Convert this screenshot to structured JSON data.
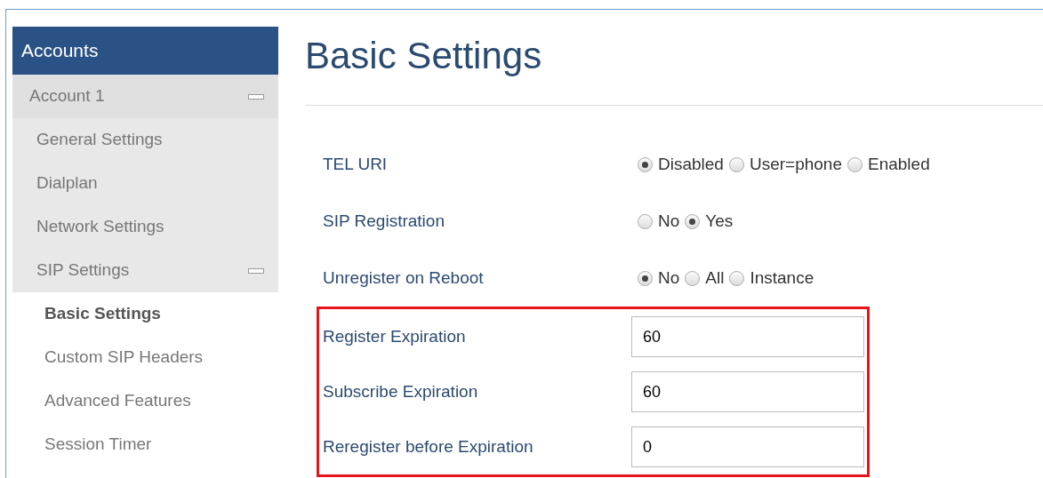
{
  "sidebar": {
    "header": "Accounts",
    "items": [
      {
        "kind": "group",
        "label": "Account 1",
        "expanded": true,
        "selected": false
      },
      {
        "kind": "item",
        "label": "General Settings",
        "selected": false
      },
      {
        "kind": "item",
        "label": "Dialplan",
        "selected": false
      },
      {
        "kind": "item",
        "label": "Network Settings",
        "selected": false
      },
      {
        "kind": "item",
        "label": "SIP Settings",
        "expanded": true,
        "selected": false
      },
      {
        "kind": "subitem",
        "label": "Basic Settings",
        "selected": true
      },
      {
        "kind": "subitem",
        "label": "Custom SIP Headers",
        "selected": false
      },
      {
        "kind": "subitem",
        "label": "Advanced Features",
        "selected": false
      },
      {
        "kind": "subitem",
        "label": "Session Timer",
        "selected": false
      }
    ]
  },
  "page_title": "Basic Settings",
  "radio_settings": [
    {
      "label": "TEL URI",
      "options": [
        {
          "label": "Disabled",
          "selected": true
        },
        {
          "label": "User=phone",
          "selected": false
        },
        {
          "label": "Enabled",
          "selected": false
        }
      ]
    },
    {
      "label": "SIP Registration",
      "options": [
        {
          "label": "No",
          "selected": false
        },
        {
          "label": "Yes",
          "selected": true
        }
      ]
    },
    {
      "label": "Unregister on Reboot",
      "options": [
        {
          "label": "No",
          "selected": true
        },
        {
          "label": "All",
          "selected": false
        },
        {
          "label": "Instance",
          "selected": false
        }
      ]
    }
  ],
  "field_settings": {
    "highlighted": true,
    "rows": [
      {
        "label": "Register Expiration",
        "value": "60"
      },
      {
        "label": "Subscribe Expiration",
        "value": "60"
      },
      {
        "label": "Reregister before Expiration",
        "value": "0"
      }
    ]
  }
}
